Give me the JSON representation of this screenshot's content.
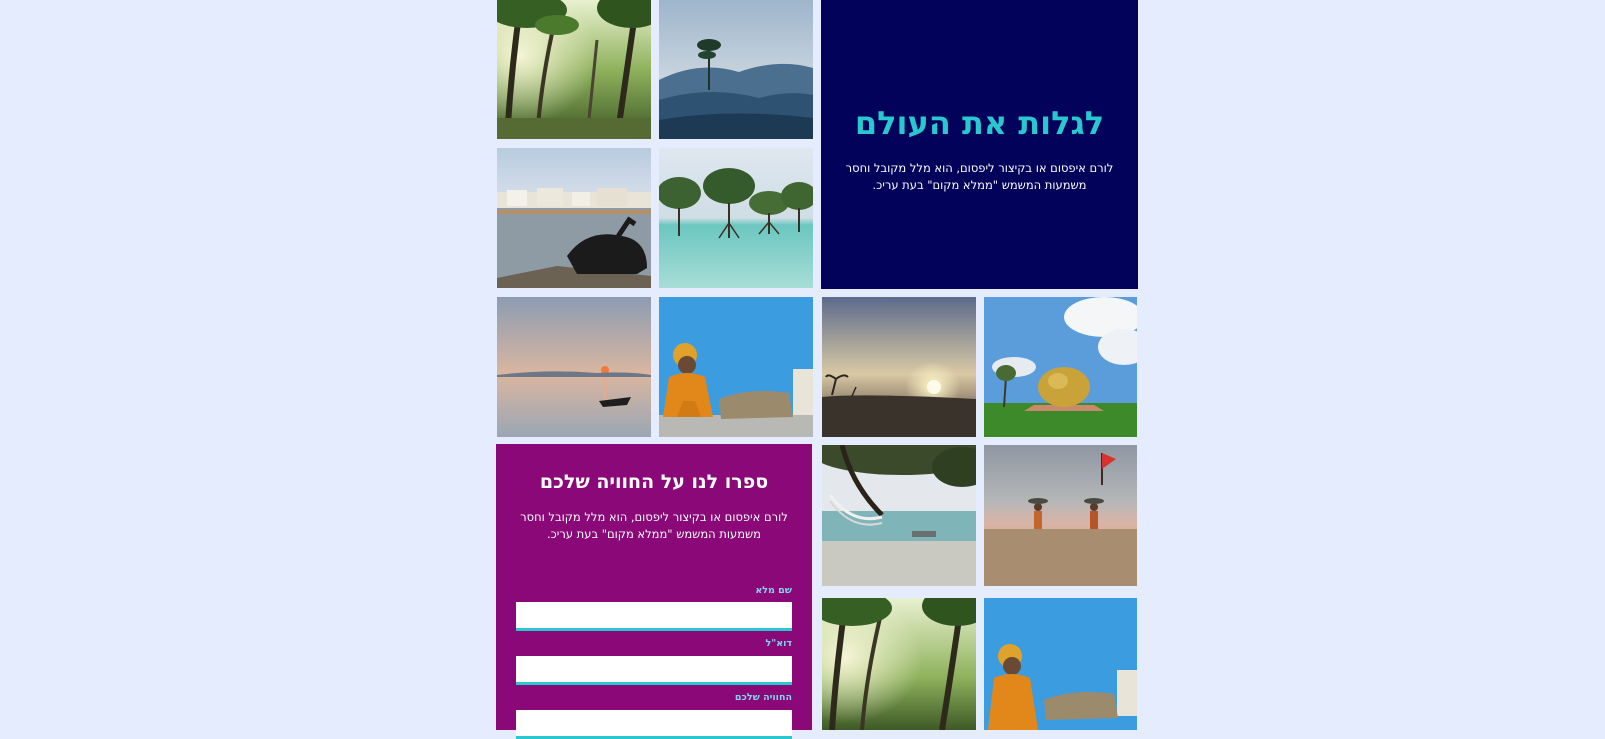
{
  "hero": {
    "title": "לגלות את העולם",
    "description": "לורם איפסום או בקיצור ליפסום, הוא מלל מקובל וחסר משמעות המשמש \"ממלא מקום\" בעת עריכ."
  },
  "feedback": {
    "title": "ספרו לנו על החוויה שלכם",
    "description": "לורם איפסום או בקיצור ליפסום, הוא מלל מקובל וחסר משמעות המשמש \"ממלא מקום\" בעת עריכ.",
    "fields": [
      {
        "label": "שם מלא",
        "value": ""
      },
      {
        "label": "דוא\"ל",
        "value": ""
      },
      {
        "label": "החוויה שלכם",
        "value": ""
      }
    ]
  },
  "colors": {
    "page_background": "#e4ecfd",
    "hero_background": "#02025a",
    "hero_title": "#29c7cf",
    "form_background": "#8a0877",
    "field_label": "#7fd4ee",
    "field_underline": "#29c7cf"
  },
  "gallery": [
    {
      "subject": "palm-forest-photo"
    },
    {
      "subject": "misty-mountain-photo"
    },
    {
      "subject": "lake-cow-photo"
    },
    {
      "subject": "mangrove-photo"
    },
    {
      "subject": "boat-sunset-photo"
    },
    {
      "subject": "seated-man-blue-wall-photo"
    },
    {
      "subject": "beach-sunset-photo"
    },
    {
      "subject": "golden-dome-photo"
    },
    {
      "subject": "hammock-beach-photo"
    },
    {
      "subject": "beach-walkers-photo"
    },
    {
      "subject": "palm-forest-photo"
    },
    {
      "subject": "seated-man-blue-wall-photo"
    }
  ]
}
